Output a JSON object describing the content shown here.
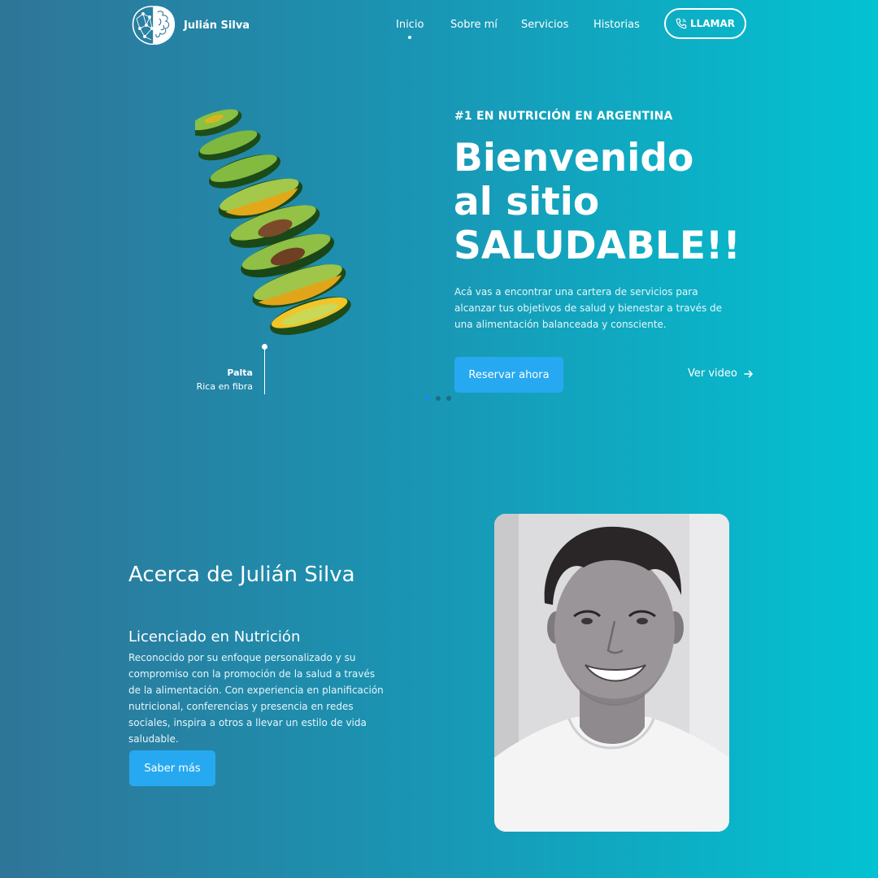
{
  "brand": {
    "name": "Julián Silva",
    "logo_icon": "brain-icon"
  },
  "nav": {
    "items": [
      {
        "label": "Inicio",
        "active": true
      },
      {
        "label": "Sobre mí",
        "active": false
      },
      {
        "label": "Servicios",
        "active": false
      },
      {
        "label": "Historias",
        "active": false
      }
    ],
    "call_label": "LLAMAR",
    "call_icon": "phone-icon"
  },
  "hero": {
    "kicker": "#1 EN NUTRICIÓN EN ARGENTINA",
    "title_lines": [
      "Bienvenido",
      "al sitio",
      "SALUDABLE!!"
    ],
    "description": "Acá vas a encontrar una cartera de servicios para alcanzar tus objetivos de salud y bienestar a través de una alimentación balanceada y consciente.",
    "primary_button": "Reservar ahora",
    "secondary_link": "Ver video",
    "image_caption_title": "Palta",
    "image_caption_subtitle": "Rica en fibra",
    "slider": {
      "count": 3,
      "active_index": 0
    }
  },
  "about": {
    "title": "Acerca de Julián Silva",
    "subtitle": "Licenciado en Nutrición",
    "description": "Reconocido por su enfoque personalizado y su compromiso con la promoción de la salud a través de la alimentación. Con experiencia en planificación nutricional, conferencias y presencia en redes sociales, inspira a otros a llevar un estilo de vida saludable.",
    "button": "Saber más"
  },
  "colors": {
    "gradient_start": "#2f7598",
    "gradient_end": "#03c2d2",
    "accent_button": "#27a9f1",
    "slider_active": "#1e88e5"
  }
}
